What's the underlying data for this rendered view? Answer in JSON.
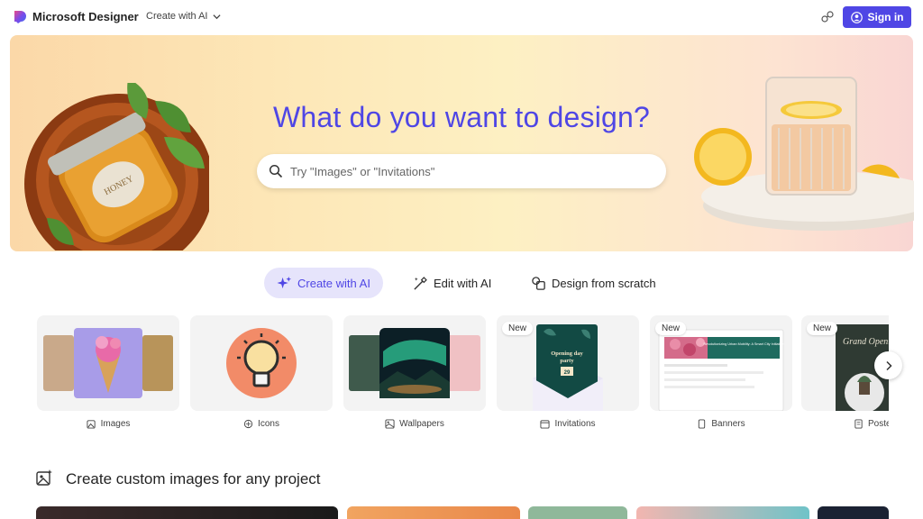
{
  "header": {
    "brand": "Microsoft Designer",
    "create_menu_label": "Create with AI",
    "signin_label": "Sign in"
  },
  "hero": {
    "title": "What do you want to design?",
    "search_placeholder": "Try \"Images\" or \"Invitations\""
  },
  "tabs": [
    {
      "label": "Create with AI",
      "icon": "sparkle-icon",
      "active": true
    },
    {
      "label": "Edit with AI",
      "icon": "magic-wand-icon",
      "active": false
    },
    {
      "label": "Design from scratch",
      "icon": "shapes-icon",
      "active": false
    }
  ],
  "cards": [
    {
      "label": "Images",
      "icon": "image-sparkle-icon",
      "badge": ""
    },
    {
      "label": "Icons",
      "icon": "icon-shapes-icon",
      "badge": ""
    },
    {
      "label": "Wallpapers",
      "icon": "wallpaper-icon",
      "badge": ""
    },
    {
      "label": "Invitations",
      "icon": "calendar-icon",
      "badge": "New"
    },
    {
      "label": "Banners",
      "icon": "phone-icon",
      "badge": "New"
    },
    {
      "label": "Poster",
      "icon": "document-icon",
      "badge": "New"
    }
  ],
  "invitation_card": {
    "line1": "Opening day",
    "line2": "party",
    "date": "29"
  },
  "banner_card": {
    "headline": "Revolutionizing Urban Mobility: A Smart City Initiative"
  },
  "poster_card": {
    "text": "Grand Opening"
  },
  "section": {
    "title": "Create custom images for any project"
  },
  "colors": {
    "accent": "#4f46e5",
    "active_tab_bg": "#e6e4fb"
  }
}
